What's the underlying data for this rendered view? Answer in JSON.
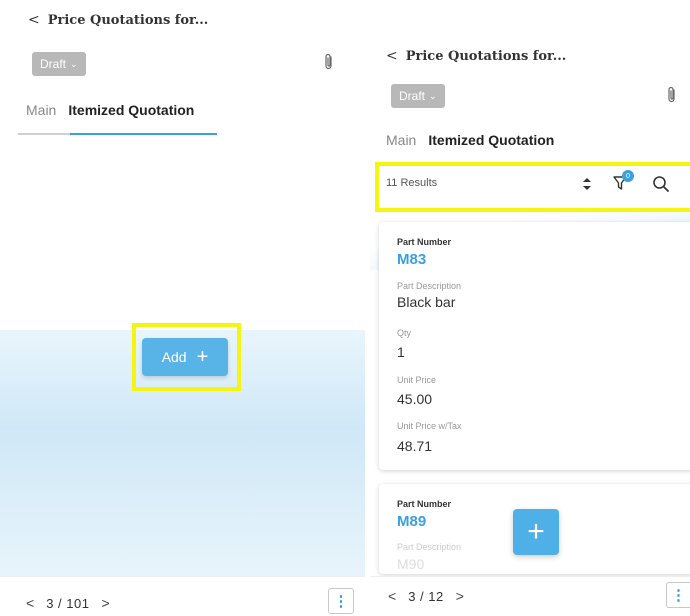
{
  "left": {
    "header": {
      "back_glyph": "<",
      "title": "Price Quotations for..."
    },
    "status": {
      "label": "Draft",
      "chevron": "⌄"
    },
    "tabs": [
      {
        "label": "Main"
      },
      {
        "label": "Itemized Quotation"
      }
    ],
    "add_button": {
      "label": "Add",
      "plus": "+"
    },
    "pager": {
      "prev": "<",
      "text": "3 / 101",
      "next": ">"
    },
    "more_glyph": "⋮"
  },
  "right": {
    "header": {
      "back_glyph": "<",
      "title": "Price Quotations for..."
    },
    "status": {
      "label": "Draft",
      "chevron": "⌄"
    },
    "tabs": [
      {
        "label": "Main"
      },
      {
        "label": "Itemized Quotation"
      }
    ],
    "results": {
      "text": "11 Results",
      "filter_count": "0"
    },
    "cards": [
      {
        "fields": [
          {
            "label": "Part Number",
            "value": "M83"
          },
          {
            "label": "Part Description",
            "value": "Black bar"
          },
          {
            "label": "Qty",
            "value": "1"
          },
          {
            "label": "Unit Price",
            "value": "45.00"
          },
          {
            "label": "Unit Price w/Tax",
            "value": "48.71"
          }
        ]
      },
      {
        "fields": [
          {
            "label": "Part Number",
            "value": "M89"
          },
          {
            "label": "Part Description",
            "value": "M90"
          }
        ]
      }
    ],
    "fab_plus": "+",
    "pager": {
      "prev": "<",
      "text": "3 / 12",
      "next": ">"
    },
    "more_glyph": "⋮"
  },
  "colors": {
    "accent": "#3aa0e0",
    "highlight": "#f5f50f",
    "draft_bg": "#b8b8b8"
  },
  "icons": {
    "attachment": "paperclip-icon",
    "sort": "sort-icon",
    "filter": "filter-icon",
    "search": "search-icon"
  }
}
